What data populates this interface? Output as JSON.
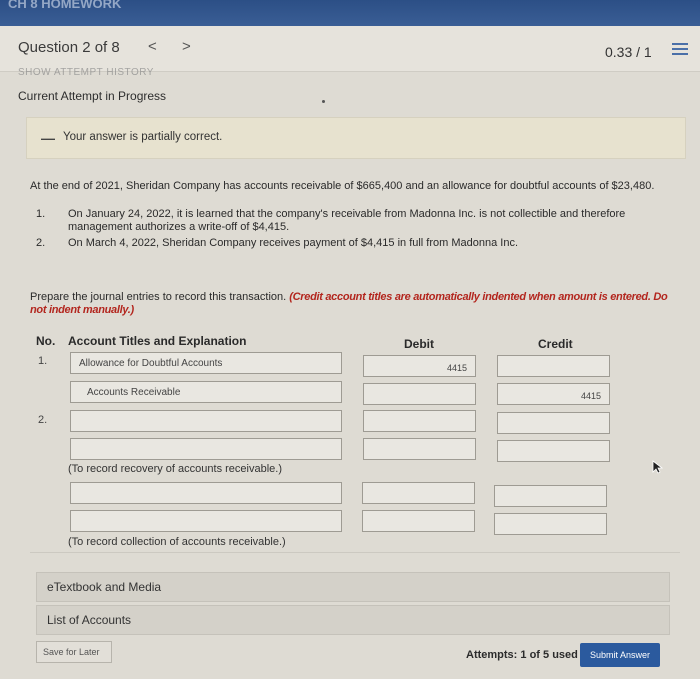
{
  "topbar": {
    "title": "CH 8 HOMEWORK"
  },
  "header": {
    "question": "Question 2 of 8",
    "prev": "<",
    "next": ">",
    "score": "0.33 / 1"
  },
  "attempt": {
    "history_link": "SHOW ATTEMPT HISTORY",
    "current": "Current Attempt in Progress",
    "feedback": "Your answer is partially correct."
  },
  "problem": {
    "intro": "At the end of 2021, Sheridan Company has accounts receivable of $665,400 and an allowance for doubtful accounts of $23,480.",
    "items": [
      {
        "num": "1.",
        "line1": "On January 24, 2022, it is learned that the company's receivable from Madonna Inc. is not collectible and therefore",
        "line2": "management authorizes a write-off of $4,415."
      },
      {
        "num": "2.",
        "line1": "On March 4, 2022, Sheridan Company receives payment of $4,415 in full from Madonna Inc.",
        "line2": ""
      }
    ],
    "prompt": "Prepare the journal entries to record this transaction.",
    "prompt_note": "(Credit account titles are automatically indented when amount is entered. Do not indent manually.)"
  },
  "table": {
    "col_no": "No.",
    "col_account": "Account Titles and Explanation",
    "col_debit": "Debit",
    "col_credit": "Credit",
    "entries": [
      {
        "num": "1.",
        "rows": [
          {
            "account": "Allowance for Doubtful Accounts",
            "debit": "4415",
            "credit": ""
          },
          {
            "account": "Accounts Receivable",
            "debit": "",
            "credit": "4415"
          }
        ]
      },
      {
        "num": "2.",
        "rows": [
          {
            "account": "",
            "debit": "",
            "credit": ""
          },
          {
            "account": "",
            "debit": "",
            "credit": ""
          }
        ],
        "note": "(To record recovery of accounts receivable.)"
      },
      {
        "num": "",
        "rows": [
          {
            "account": "",
            "debit": "",
            "credit": ""
          },
          {
            "account": "",
            "debit": "",
            "credit": ""
          }
        ],
        "note": "(To record collection of accounts receivable.)"
      }
    ]
  },
  "links": {
    "etextbook": "eTextbook and Media",
    "accounts": "List of Accounts"
  },
  "footer": {
    "save": "Save for Later",
    "attempts_label": "Attempts:",
    "attempts_value": "1 of 5 used",
    "submit": "Submit Answer"
  },
  "colors": {
    "accent": "#2b5a9e",
    "instruction_red": "#b3261e",
    "feedback_bg": "#e7e2cf"
  },
  "icons": {
    "menu": "hamburger-menu-icon",
    "cursor": "mouse-cursor-icon"
  }
}
